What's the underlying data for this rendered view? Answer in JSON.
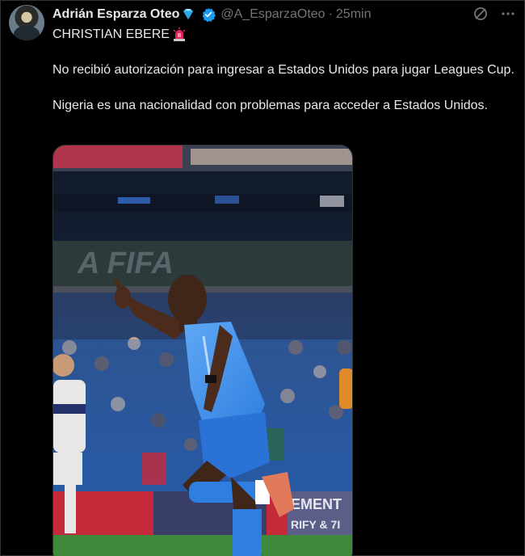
{
  "author": {
    "name": "Adrián Esparza Oteo",
    "handle": "@A_EsparzaOteo",
    "time": "25min",
    "separator": "·"
  },
  "tweet": {
    "headline": "CHRISTIAN EBERE",
    "paragraph1": "No recibió autorización para ingresar a Estados Unidos para jugar Leagues Cup.",
    "paragraph2": "Nigeria es una nacionalidad con problemas para acceder a Estados Unidos."
  },
  "icons": {
    "diamond": "gem-icon",
    "verified": "verified-badge-icon",
    "siren": "police-light-icon",
    "grok": "grok-icon",
    "more": "more-icon"
  },
  "colors": {
    "background": "#000000",
    "text": "#e7e9ea",
    "muted": "#71767b",
    "verified": "#1d9bf0"
  },
  "media": {
    "banner_text": "A FIFA",
    "ad_text": "EMENT\nRIFY & 7I"
  }
}
